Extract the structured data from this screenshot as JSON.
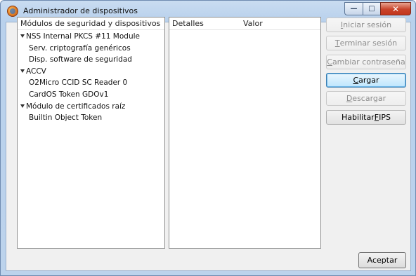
{
  "window": {
    "title": "Administrador de dispositivos"
  },
  "tree": {
    "header": "Módulos de seguridad y dispositivos",
    "items": [
      {
        "label": "NSS Internal PKCS #11 Module",
        "level": 0,
        "expanded": true
      },
      {
        "label": "Serv. criptografía genéricos",
        "level": 1
      },
      {
        "label": "Disp. software de seguridad",
        "level": 1
      },
      {
        "label": "ACCV",
        "level": 0,
        "expanded": true
      },
      {
        "label": "O2Micro CCID SC Reader 0",
        "level": 1
      },
      {
        "label": "CardOS Token GDOv1",
        "level": 1
      },
      {
        "label": "Módulo de certificados raíz",
        "level": 0,
        "expanded": true
      },
      {
        "label": "Builtin Object Token",
        "level": 1
      }
    ]
  },
  "details": {
    "col1": "Detalles",
    "col2": "Valor"
  },
  "buttons": {
    "login": {
      "pre": "",
      "key": "I",
      "post": "niciar sesión",
      "enabled": false
    },
    "logout": {
      "pre": "",
      "key": "T",
      "post": "erminar sesión",
      "enabled": false
    },
    "change_password": {
      "pre": "",
      "key": "C",
      "post": "ambiar contraseña",
      "enabled": false
    },
    "load": {
      "pre": "",
      "key": "C",
      "post": "argar",
      "enabled": true,
      "focused": true
    },
    "unload": {
      "pre": "",
      "key": "D",
      "post": "escargar",
      "enabled": false
    },
    "fips": {
      "pre": "Habilitar ",
      "key": "F",
      "post": "IPS",
      "enabled": true
    }
  },
  "accept": {
    "label": "Aceptar"
  }
}
